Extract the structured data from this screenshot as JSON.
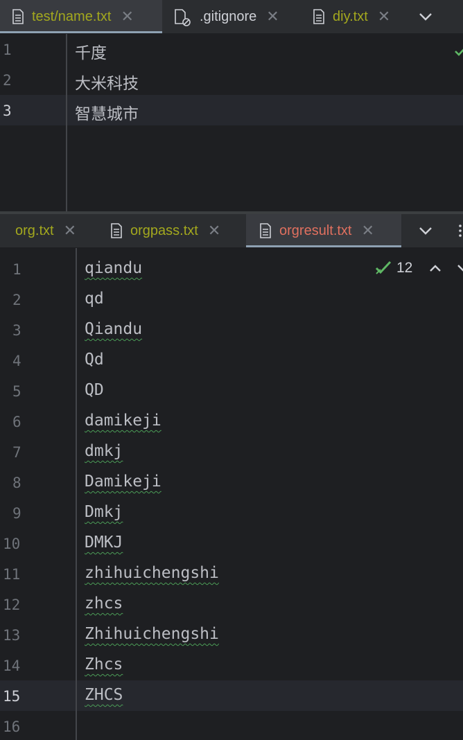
{
  "top_pane": {
    "tabs": [
      {
        "label": "test/name.txt",
        "active": true,
        "color": "#a3a81e"
      },
      {
        "label": ".gitignore",
        "active": false,
        "color": "#ced0d6"
      },
      {
        "label": "diy.txt",
        "active": false,
        "color": "#a3a81e"
      }
    ],
    "lines": [
      {
        "num": "1",
        "text": "千度"
      },
      {
        "num": "2",
        "text": "大米科技"
      },
      {
        "num": "3",
        "text": "智慧城市"
      }
    ]
  },
  "bottom_pane": {
    "tabs": [
      {
        "label": "org.txt",
        "active": false,
        "color": "#a3a81e"
      },
      {
        "label": "orgpass.txt",
        "active": false,
        "color": "#a3a81e"
      },
      {
        "label": "orgresult.txt",
        "active": true,
        "color": "#e0705f"
      }
    ],
    "inspection_count": "12",
    "lines": [
      {
        "num": "1",
        "text": "qiandu"
      },
      {
        "num": "2",
        "text": "qd"
      },
      {
        "num": "3",
        "text": "Qiandu"
      },
      {
        "num": "4",
        "text": "Qd"
      },
      {
        "num": "5",
        "text": "QD"
      },
      {
        "num": "6",
        "text": "damikeji"
      },
      {
        "num": "7",
        "text": "dmkj"
      },
      {
        "num": "8",
        "text": "Damikeji"
      },
      {
        "num": "9",
        "text": "Dmkj"
      },
      {
        "num": "10",
        "text": "DMKJ"
      },
      {
        "num": "11",
        "text": "zhihuichengshi"
      },
      {
        "num": "12",
        "text": "zhcs"
      },
      {
        "num": "13",
        "text": "Zhihuichengshi"
      },
      {
        "num": "14",
        "text": "Zhcs"
      },
      {
        "num": "15",
        "text": "ZHCS"
      },
      {
        "num": "16",
        "text": ""
      }
    ]
  }
}
